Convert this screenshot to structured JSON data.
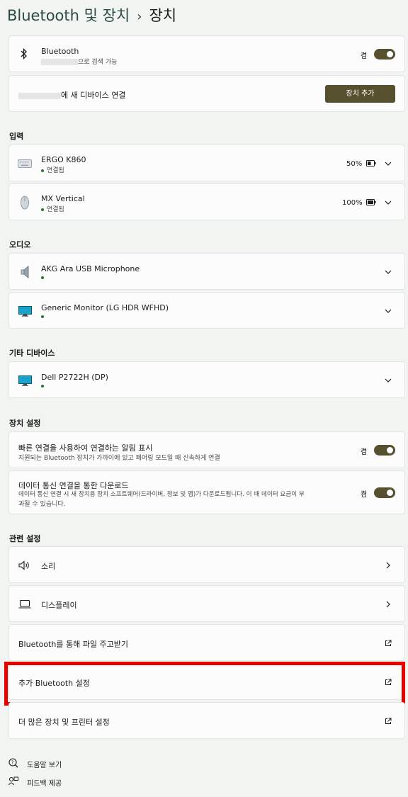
{
  "header": {
    "crumb": "Bluetooth 및 장치",
    "separator": "›",
    "current": "장치"
  },
  "bluetooth": {
    "title": "Bluetooth",
    "subtitle_suffix": "으로 검색 가능",
    "toggle_label": "켬"
  },
  "add_device": {
    "label_suffix": "에 새 디바이스 연결",
    "button": "장치 추가"
  },
  "input": {
    "title": "입력",
    "devices": [
      {
        "name": "ERGO K860",
        "status": "연결됨",
        "battery": "50%",
        "icon": "keyboard-icon"
      },
      {
        "name": "MX Vertical",
        "status": "연결됨",
        "battery": "100%",
        "icon": "mouse-icon"
      }
    ]
  },
  "audio": {
    "title": "오디오",
    "devices": [
      {
        "name": "AKG Ara USB Microphone",
        "icon": "speaker-icon"
      },
      {
        "name": "Generic Monitor (LG HDR WFHD)",
        "icon": "monitor-icon"
      }
    ]
  },
  "other": {
    "title": "기타 디바이스",
    "devices": [
      {
        "name": "Dell P2722H (DP)",
        "icon": "monitor-icon"
      }
    ]
  },
  "device_settings": {
    "title": "장치 설정",
    "swift_pair": {
      "title": "빠른 연결을 사용하여 연결하는 알림 표시",
      "desc": "지원되는 Bluetooth 장치가 가까이에 있고 페어링 모드일 때 신속하게 연결",
      "toggle_label": "켬"
    },
    "metered": {
      "title": "데이터 통신 연결을 통한 다운로드",
      "desc_line1": "데이터 통신 연결 시 새 장치용 장치 소프트웨어(드라이버, 정보 및 앱)가 다운로드됩니다. 이 때 데이터 요금이 부",
      "desc_line2": "과될 수 있습니다.",
      "toggle_label": "켬"
    }
  },
  "related": {
    "title": "관련 설정",
    "items": [
      {
        "label": "소리",
        "icon": "volume-icon",
        "action": "chevron"
      },
      {
        "label": "디스플레이",
        "icon": "display-icon",
        "action": "chevron"
      },
      {
        "label": "Bluetooth를 통해 파일 주고받기",
        "action": "external"
      },
      {
        "label": "추가 Bluetooth 설정",
        "action": "external"
      },
      {
        "label": "더 많은 장치 및 프린터 설정",
        "action": "external"
      }
    ]
  },
  "footer": {
    "help": "도움말 보기",
    "feedback": "피드백 제공"
  },
  "colors": {
    "accent": "#57502e",
    "connected": "#1e7d3a",
    "highlight": "#e50000"
  }
}
